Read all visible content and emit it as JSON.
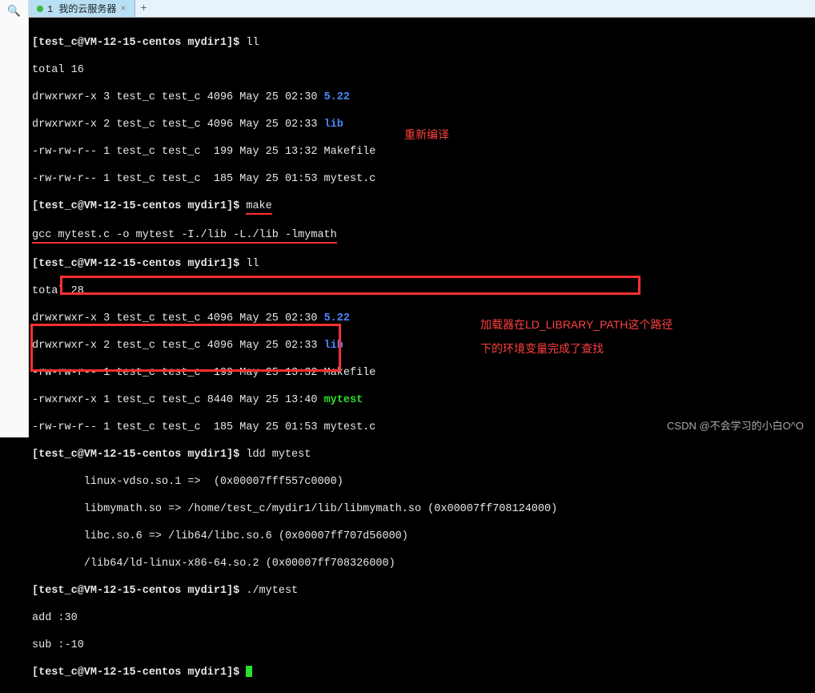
{
  "tab": {
    "title": "1 我的云服务器"
  },
  "leftbar": {
    "search": "🔍"
  },
  "lines": {
    "l1_prompt": "[test_c@VM-12-15-centos mydir1]$ ",
    "l1_cmd": "ll",
    "l2": "total 16",
    "l3a": "drwxrwxr-x 3 test_c test_c 4096 May 25 02:30 ",
    "l3b": "5.22",
    "l4a": "drwxrwxr-x 2 test_c test_c 4096 May 25 02:33 ",
    "l4b": "lib",
    "l5": "-rw-rw-r-- 1 test_c test_c  199 May 25 13:32 Makefile",
    "l6": "-rw-rw-r-- 1 test_c test_c  185 May 25 01:53 mytest.c",
    "l7_prompt": "[test_c@VM-12-15-centos mydir1]$ ",
    "l7_cmd": "make",
    "l8": "gcc mytest.c -o mytest -I./lib -L./lib -lmymath",
    "l9_prompt": "[test_c@VM-12-15-centos mydir1]$ ",
    "l9_cmd": "ll",
    "l10": "total 28",
    "l11a": "drwxrwxr-x 3 test_c test_c 4096 May 25 02:30 ",
    "l11b": "5.22",
    "l12a": "drwxrwxr-x 2 test_c test_c 4096 May 25 02:33 ",
    "l12b": "lib",
    "l13": "-rw-rw-r-- 1 test_c test_c  199 May 25 13:32 Makefile",
    "l14a": "-rwxrwxr-x 1 test_c test_c 8440 May 25 13:40 ",
    "l14b": "mytest",
    "l15": "-rw-rw-r-- 1 test_c test_c  185 May 25 01:53 mytest.c",
    "l16_prompt": "[test_c@VM-12-15-centos mydir1]$ ",
    "l16_cmd": "ldd mytest",
    "l17": "        linux-vdso.so.1 =>  (0x00007fff557c0000)",
    "l18": "        libmymath.so => /home/test_c/mydir1/lib/libmymath.so (0x00007ff708124000)",
    "l19": "        libc.so.6 => /lib64/libc.so.6 (0x00007ff707d56000)",
    "l20": "        /lib64/ld-linux-x86-64.so.2 (0x00007ff708326000)",
    "l21_prompt": "[test_c@VM-12-15-centos mydir1]$ ",
    "l21_cmd": "./mytest",
    "l22": "add :30",
    "l23": "sub :-10",
    "l24_prompt": "[test_c@VM-12-15-centos mydir1]$ "
  },
  "annotations": {
    "a1": "重新编译",
    "a2": "加载器在LD_LIBRARY_PATH这个路径",
    "a3": "下的环境变量完成了查找"
  },
  "watermark": "CSDN @不会学习的小白O^O"
}
